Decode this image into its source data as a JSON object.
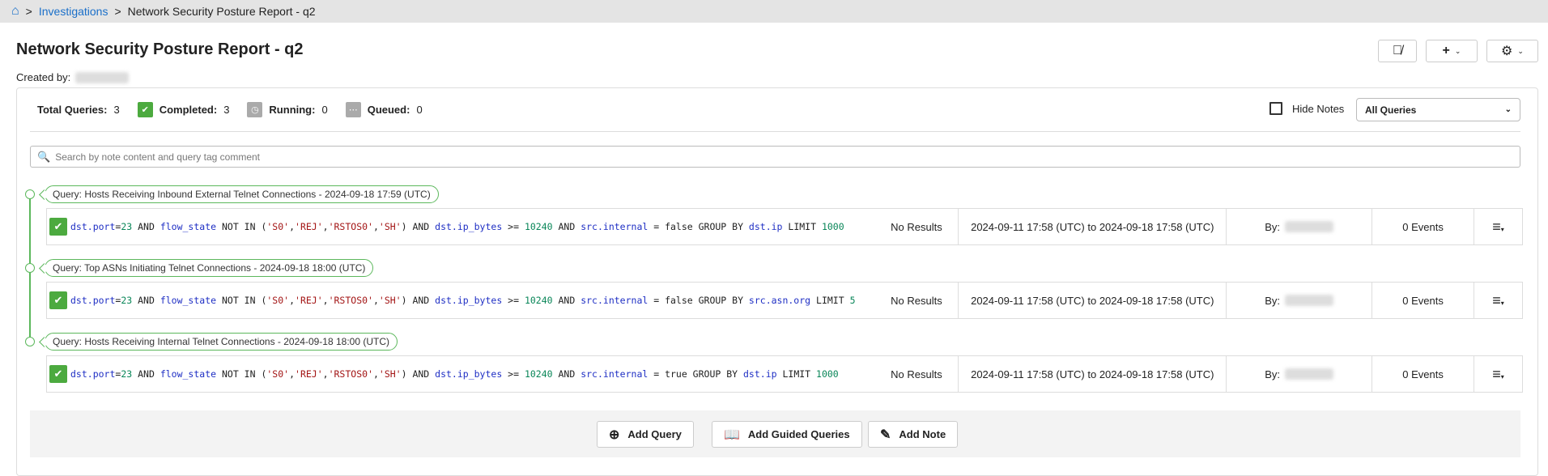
{
  "breadcrumb": {
    "home_icon": "home-icon",
    "link": "Investigations",
    "current": "Network Security Posture Report - q2",
    "sep": ">"
  },
  "title": "Network Security Posture Report - q2",
  "created_by_label": "Created by:",
  "toolbar": {
    "hide_icon": "eye-slash-icon",
    "add_icon": "+",
    "settings_icon": "gear-icon"
  },
  "stats": {
    "total_label": "Total Queries:",
    "total": "3",
    "completed_label": "Completed:",
    "completed": "3",
    "running_label": "Running:",
    "running": "0",
    "queued_label": "Queued:",
    "queued": "0"
  },
  "hide_notes": "Hide Notes",
  "filter": "All Queries",
  "search_placeholder": "Search by note content and query tag comment",
  "queries": [
    {
      "tag": "Query: Hosts Receiving Inbound External Telnet Connections - 2024-09-18 17:59 (UTC)",
      "tokens": [
        [
          "f",
          "dst.port"
        ],
        [
          "k",
          "="
        ],
        [
          "n",
          "23"
        ],
        [
          "k",
          " AND "
        ],
        [
          "f",
          "flow_state"
        ],
        [
          "k",
          " NOT IN ("
        ],
        [
          "s",
          "'S0'"
        ],
        [
          "k",
          ","
        ],
        [
          "s",
          "'REJ'"
        ],
        [
          "k",
          ","
        ],
        [
          "s",
          "'RSTOS0'"
        ],
        [
          "k",
          ","
        ],
        [
          "s",
          "'SH'"
        ],
        [
          "k",
          ") AND "
        ],
        [
          "f",
          "dst.ip_bytes"
        ],
        [
          "k",
          " >= "
        ],
        [
          "n",
          "10240"
        ],
        [
          "k",
          " AND "
        ],
        [
          "f",
          "src.internal"
        ],
        [
          "k",
          " = false GROUP BY "
        ],
        [
          "f",
          "dst.ip"
        ],
        [
          "k",
          " LIMIT "
        ],
        [
          "n",
          "1000"
        ]
      ],
      "results": "No Results",
      "range": "2024-09-11 17:58 (UTC) to 2024-09-18 17:58 (UTC)",
      "by": "By:",
      "events": "0 Events"
    },
    {
      "tag": "Query: Top ASNs Initiating Telnet Connections - 2024-09-18 18:00 (UTC)",
      "tokens": [
        [
          "f",
          "dst.port"
        ],
        [
          "k",
          "="
        ],
        [
          "n",
          "23"
        ],
        [
          "k",
          " AND "
        ],
        [
          "f",
          "flow_state"
        ],
        [
          "k",
          " NOT IN ("
        ],
        [
          "s",
          "'S0'"
        ],
        [
          "k",
          ","
        ],
        [
          "s",
          "'REJ'"
        ],
        [
          "k",
          ","
        ],
        [
          "s",
          "'RSTOS0'"
        ],
        [
          "k",
          ","
        ],
        [
          "s",
          "'SH'"
        ],
        [
          "k",
          ") AND "
        ],
        [
          "f",
          "dst.ip_bytes"
        ],
        [
          "k",
          " >= "
        ],
        [
          "n",
          "10240"
        ],
        [
          "k",
          " AND "
        ],
        [
          "f",
          "src.internal"
        ],
        [
          "k",
          " = false GROUP BY "
        ],
        [
          "f",
          "src.asn.org"
        ],
        [
          "k",
          " LIMIT "
        ],
        [
          "n",
          "5"
        ]
      ],
      "results": "No Results",
      "range": "2024-09-11 17:58 (UTC) to 2024-09-18 17:58 (UTC)",
      "by": "By:",
      "events": "0 Events"
    },
    {
      "tag": "Query: Hosts Receiving Internal Telnet Connections - 2024-09-18 18:00 (UTC)",
      "tokens": [
        [
          "f",
          "dst.port"
        ],
        [
          "k",
          "="
        ],
        [
          "n",
          "23"
        ],
        [
          "k",
          " AND "
        ],
        [
          "f",
          "flow_state"
        ],
        [
          "k",
          " NOT IN ("
        ],
        [
          "s",
          "'S0'"
        ],
        [
          "k",
          ","
        ],
        [
          "s",
          "'REJ'"
        ],
        [
          "k",
          ","
        ],
        [
          "s",
          "'RSTOS0'"
        ],
        [
          "k",
          ","
        ],
        [
          "s",
          "'SH'"
        ],
        [
          "k",
          ") AND "
        ],
        [
          "f",
          "dst.ip_bytes"
        ],
        [
          "k",
          " >= "
        ],
        [
          "n",
          "10240"
        ],
        [
          "k",
          " AND "
        ],
        [
          "f",
          "src.internal"
        ],
        [
          "k",
          " = true GROUP BY "
        ],
        [
          "f",
          "dst.ip"
        ],
        [
          "k",
          " LIMIT "
        ],
        [
          "n",
          "1000"
        ]
      ],
      "results": "No Results",
      "range": "2024-09-11 17:58 (UTC) to 2024-09-18 17:58 (UTC)",
      "by": "By:",
      "events": "0 Events"
    }
  ],
  "actions": {
    "add_query": "Add Query",
    "add_guided": "Add Guided Queries",
    "add_note": "Add Note"
  },
  "colors": {
    "green": "#4caa3f",
    "link": "#1a6fc9"
  }
}
